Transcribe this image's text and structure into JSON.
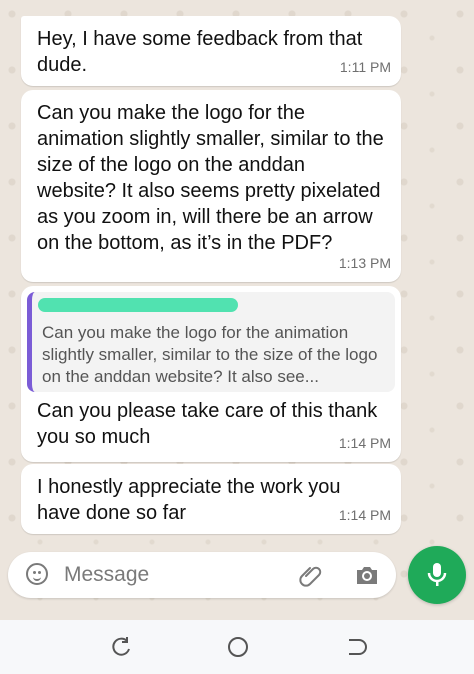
{
  "messages": [
    {
      "text": "Hey, I have some feedback from that dude.",
      "time": "1:11 PM"
    },
    {
      "text": "Can you make the logo for the animation slightly smaller, similar to the size of the logo on the anddan website? It also seems pretty pixelated as you zoom in, will there be an arrow on the bottom, as it’s in the PDF?",
      "time": "1:13 PM"
    },
    {
      "quote": "Can you make the logo for the animation slightly smaller, similar to the size of the logo on the anddan website? It also see...",
      "text": "Can you please take care of this thank you so much",
      "time": "1:14 PM"
    },
    {
      "text": "I honestly appreciate the work you have done so far",
      "time": "1:14 PM"
    }
  ],
  "composer": {
    "placeholder": "Message"
  },
  "colors": {
    "accent": "#1faa59",
    "quote_bar": "#7b5cd6",
    "redaction": "#3fe0a8"
  },
  "icons": [
    "emoji-icon",
    "attach-icon",
    "camera-icon",
    "mic-icon",
    "recents-icon",
    "home-icon",
    "back-icon"
  ]
}
